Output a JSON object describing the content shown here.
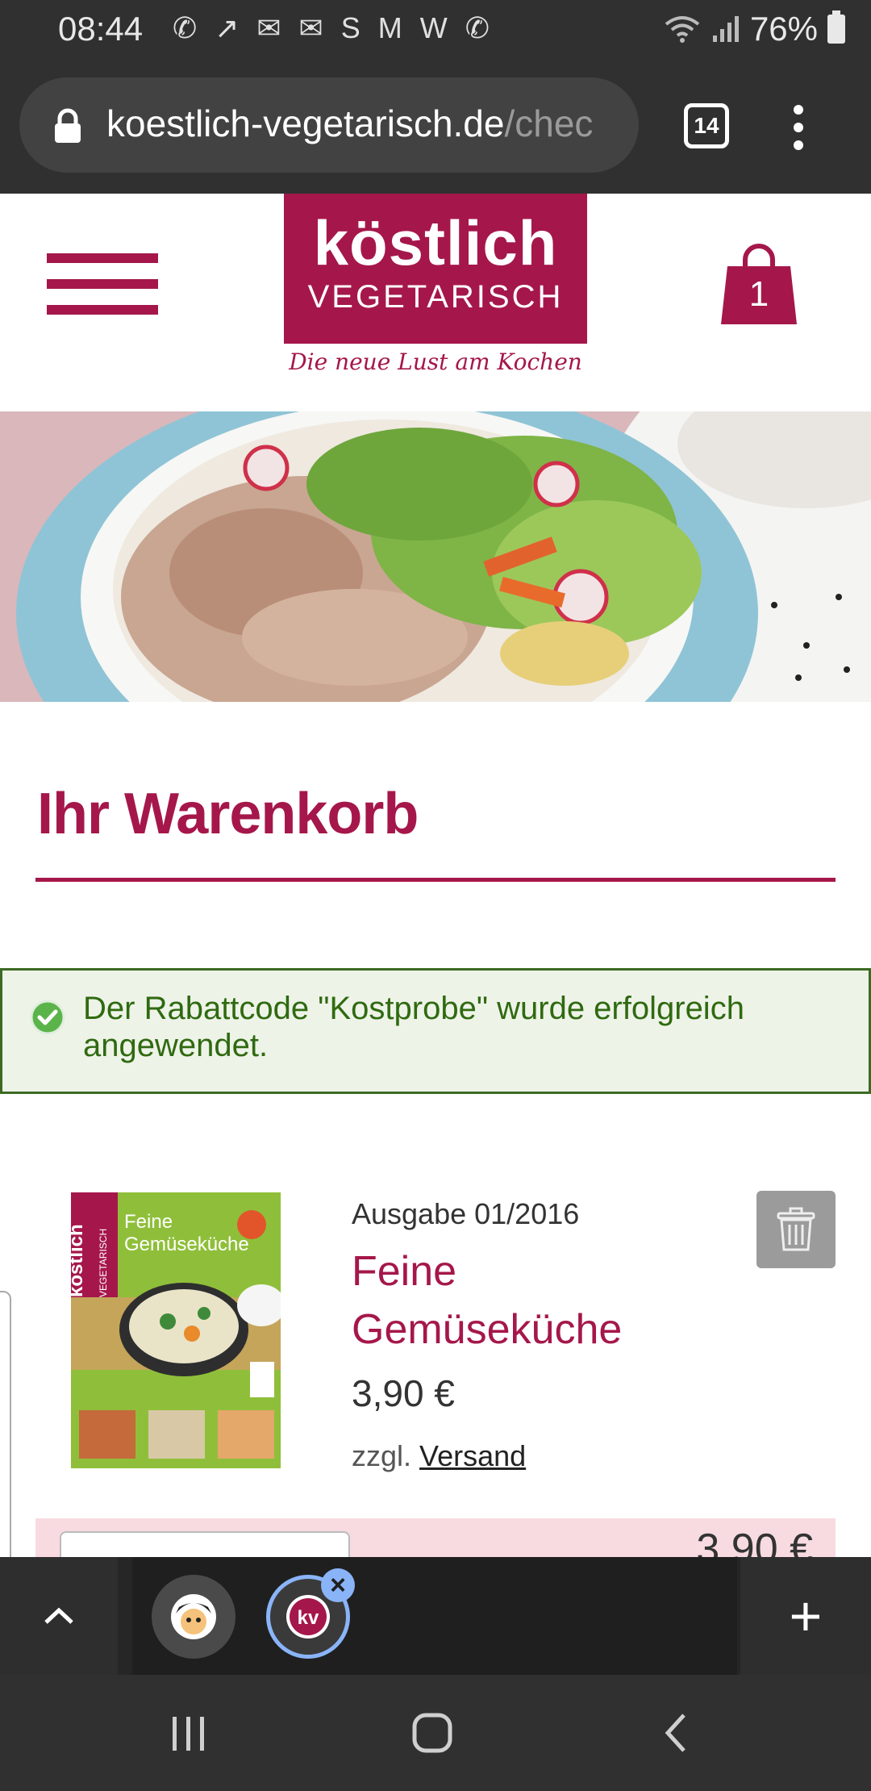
{
  "status_bar": {
    "time": "08:44",
    "battery": "76%",
    "notification_icons": [
      "whatsapp-icon",
      "signal-icon",
      "mail-icon",
      "mail-icon",
      "s-icon",
      "gmail-icon",
      "w-icon",
      "call-icon"
    ]
  },
  "browser": {
    "url_main": "koestlich-vegetarisch.de",
    "url_dim": "/chec",
    "tab_count": "14"
  },
  "site": {
    "logo_main": "köstlich",
    "logo_sub": "VEGETARISCH",
    "tagline": "Die neue Lust am Kochen",
    "cart_count": "1",
    "brand_color": "#a5174a"
  },
  "cart": {
    "title": "Ihr Warenkorb",
    "notice": "Der Rabattcode \"Kostprobe\" wurde erfolgreich angewendet.",
    "item": {
      "issue": "Ausgabe 01/2016",
      "title": "Feine Gemüseküche",
      "price": "3,90 €",
      "shipping_prefix": "zzgl.",
      "shipping_link": "Versand",
      "cover_text": {
        "brand_main": "köstlich",
        "brand_sub": "VEGETARISCH",
        "title_line1": "Feine",
        "title_line2": "Gemüseküche"
      }
    },
    "total_partial": "3,90 €"
  },
  "bottom_tabs": {
    "add_label": "+"
  }
}
